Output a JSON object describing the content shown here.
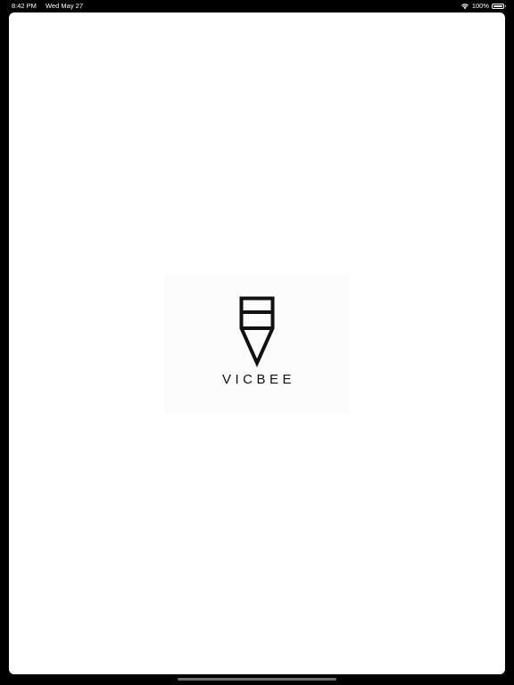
{
  "status_bar": {
    "time": "8:42 PM",
    "date": "Wed May 27",
    "battery_percent": "100%",
    "battery_level": 1.0,
    "icons": [
      "wifi-icon",
      "battery-icon"
    ]
  },
  "splash": {
    "brand_name": "VICBEE",
    "logo_icon": "vicbee-logo-icon"
  },
  "colors": {
    "background": "#000000",
    "sheet": "#ffffff",
    "logo_panel": "#fcfcfc",
    "logo": "#111111",
    "status_text": "#ffffff",
    "home_indicator": "#6e6e6e"
  }
}
